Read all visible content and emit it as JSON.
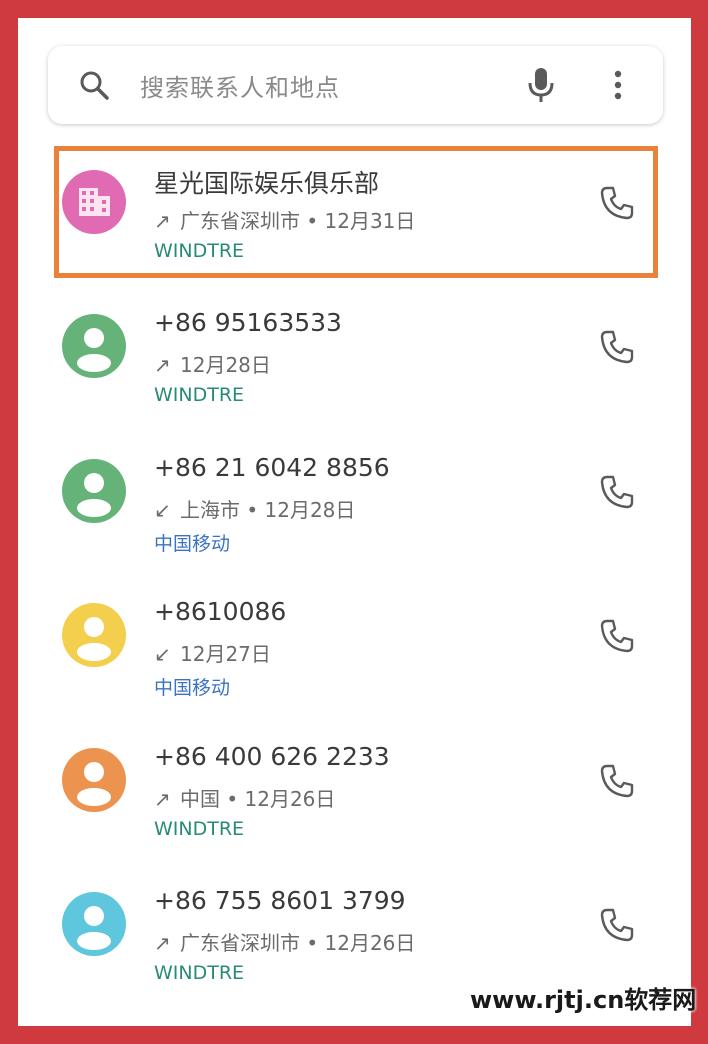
{
  "search": {
    "placeholder": "搜索联系人和地点",
    "icon": "search-icon",
    "mic_icon": "mic-icon",
    "more_icon": "more-vert-icon"
  },
  "colors": {
    "frame_border": "#cf3a3f",
    "highlight": "#e9823a",
    "carrier_windtre": "#2a8a78",
    "carrier_cmcc": "#3b73c4"
  },
  "calls": [
    {
      "name": "星光国际娱乐俱乐部",
      "direction": "outgoing",
      "direction_symbol": "↗",
      "location_date": "广东省深圳市 • 12月31日",
      "carrier": "WINDTRE",
      "avatar_color": "#e06bb3",
      "avatar_icon": "business-icon",
      "highlighted": true
    },
    {
      "name": "+86 95163533",
      "direction": "outgoing",
      "direction_symbol": "↗",
      "location_date": "12月28日",
      "carrier": "WINDTRE",
      "avatar_color": "#66b37a",
      "avatar_icon": "person-icon"
    },
    {
      "name": "+86 21 6042 8856",
      "direction": "incoming",
      "direction_symbol": "↙",
      "location_date": "上海市 • 12月28日",
      "carrier": "中国移动",
      "avatar_color": "#66b37a",
      "avatar_icon": "person-icon"
    },
    {
      "name": "+8610086",
      "direction": "incoming",
      "direction_symbol": "↙",
      "location_date": "12月27日",
      "carrier": "中国移动",
      "avatar_color": "#f4cf4d",
      "avatar_icon": "person-icon"
    },
    {
      "name": "+86 400 626 2233",
      "direction": "outgoing",
      "direction_symbol": "↗",
      "location_date": "中国 • 12月26日",
      "carrier": "WINDTRE",
      "avatar_color": "#ec9350",
      "avatar_icon": "person-icon"
    },
    {
      "name": "+86 755 8601 3799",
      "direction": "outgoing",
      "direction_symbol": "↗",
      "location_date": "广东省深圳市 • 12月26日",
      "carrier": "WINDTRE",
      "avatar_color": "#5ec6dd",
      "avatar_icon": "person-icon"
    }
  ],
  "watermark": "www.rjtj.cn软荐网"
}
